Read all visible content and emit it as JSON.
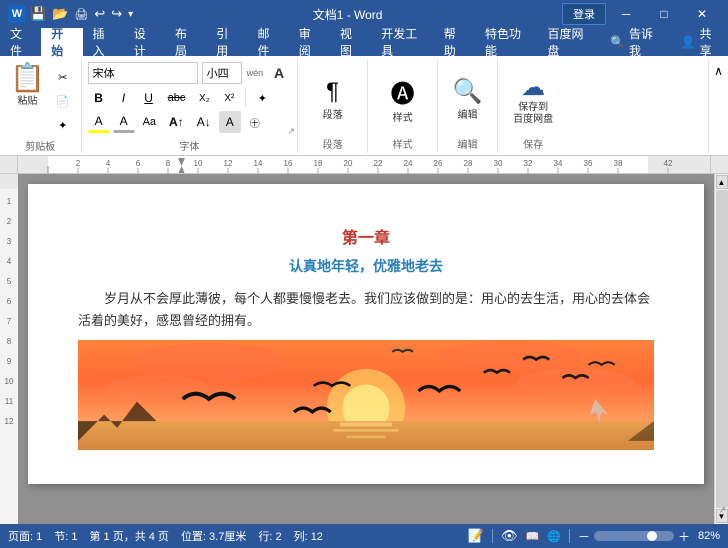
{
  "titlebar": {
    "title": "文档1 - Word",
    "login_label": "登录",
    "minimize_icon": "─",
    "restore_icon": "□",
    "close_icon": "✕",
    "quickaccess": [
      "💾",
      "📂",
      "🖨",
      "↩",
      "↪"
    ]
  },
  "menubar": {
    "items": [
      "文件",
      "开始",
      "插入",
      "设计",
      "布局",
      "引用",
      "邮件",
      "审阅",
      "视图",
      "开发工具",
      "帮助",
      "特色功能",
      "百度网盘",
      "告诉我"
    ]
  },
  "ribbon": {
    "clipboard_label": "剪贴板",
    "font_label": "字体",
    "style_label": "样式",
    "edit_label": "编辑",
    "save_label": "保存",
    "paste_label": "粘贴",
    "font_name": "宋体",
    "font_size": "小四",
    "bold": "B",
    "italic": "I",
    "underline": "U",
    "strikethrough": "abc",
    "subscript": "X₂",
    "superscript": "X²",
    "font_color_label": "A",
    "highlight_label": "A",
    "format_painter": "✦",
    "para_label": "段落",
    "style_btn_label": "样式",
    "edit_btn_label": "编辑",
    "save_btn_label": "保存到\n百度网盘",
    "save_group_label": "保存",
    "more_label": "▾",
    "wen_icon": "wén",
    "A_icon": "A",
    "size_up": "A↑",
    "size_down": "A↓"
  },
  "document": {
    "chapter_title": "第一章",
    "subtitle": "认真地年轻，优雅地老去",
    "paragraph1": "岁月从不会厚此薄彼，每个人都要慢慢老去。我们应该做到的是：用心的去生活，用心的去体会活着的美好，感恩曾经的拥有。",
    "image_alt": "日落飞鸟风景图"
  },
  "statusbar": {
    "page_label": "页面: 1",
    "section_label": "节: 1",
    "pages_label": "第 1 页，共 4 页",
    "position_label": "位置: 3.7厘米",
    "row_label": "行: 2",
    "col_label": "列: 12",
    "zoom_value": "82%",
    "zoom_minus": "－",
    "zoom_plus": "＋"
  },
  "colors": {
    "ribbon_blue": "#2b579a",
    "accent": "#1e4e87",
    "doc_red": "#c0392b",
    "doc_blue": "#2980b9"
  }
}
